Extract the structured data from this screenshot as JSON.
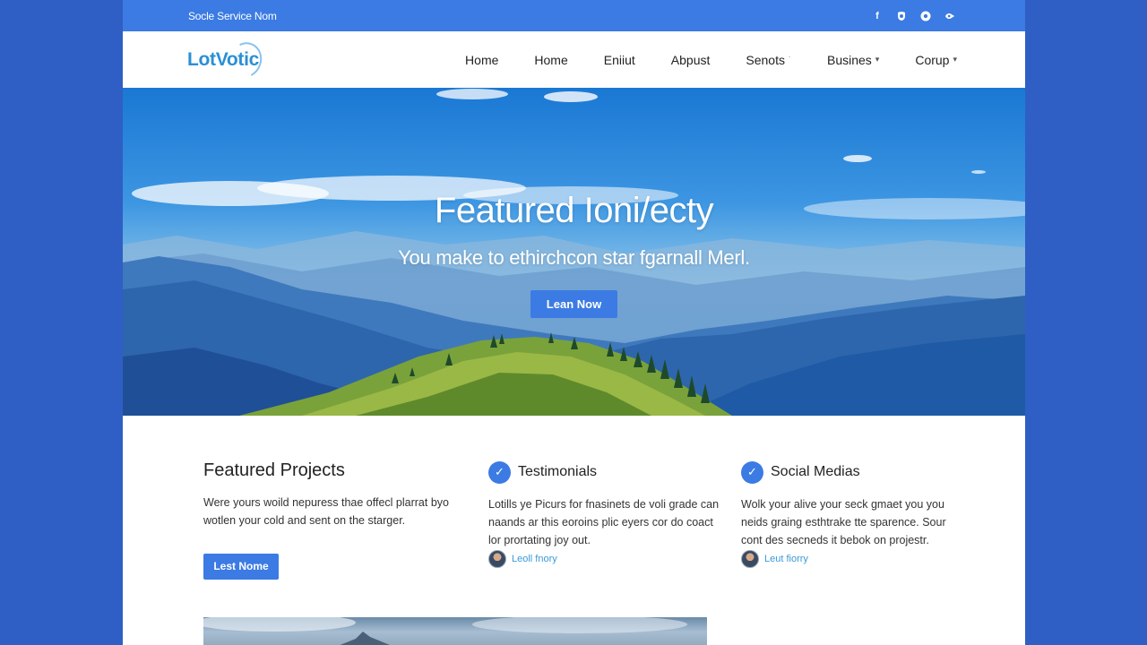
{
  "topbar": {
    "tagline": "Socle Service Nom",
    "social_icons": [
      "facebook-icon",
      "shield-icon",
      "circle-icon",
      "share-icon"
    ]
  },
  "nav": {
    "logo": "LotVotic",
    "items": [
      {
        "label": "Home"
      },
      {
        "label": "Home"
      },
      {
        "label": "Eniiut"
      },
      {
        "label": "Abpust"
      },
      {
        "label": "Senots"
      },
      {
        "label": "Busines"
      },
      {
        "label": "Corup"
      }
    ]
  },
  "hero": {
    "title": "Featured Ioni/ecty",
    "subtitle": "You make to ethirchcon star fgarnall Merl.",
    "button": "Lean Now"
  },
  "features": {
    "col1": {
      "title": "Featured Projects",
      "text": "Were yours woild nepuress thae offecl plarrat byo wotlen your cold and sent on the starger.",
      "button": "Lest Nome"
    },
    "col2": {
      "title": "Testimonials",
      "text": "Lotills ye Picurs for fnasinets de voli grade can naands ar this eoroins plic eyers cor do coact lor prortating joy out.",
      "author": "Leoll fnory"
    },
    "col3": {
      "title": "Social Medias",
      "text": "Wolk your alive your seck gmaet you you neids graing esthtrake tte sparence. Sour cont des secneds it bebok on projestr.",
      "author": "Leut fiorry"
    }
  },
  "colors": {
    "background": "#2f5fc4",
    "accent": "#3b7be3",
    "logo": "#2a8fd6",
    "link": "#3a9ad8"
  }
}
